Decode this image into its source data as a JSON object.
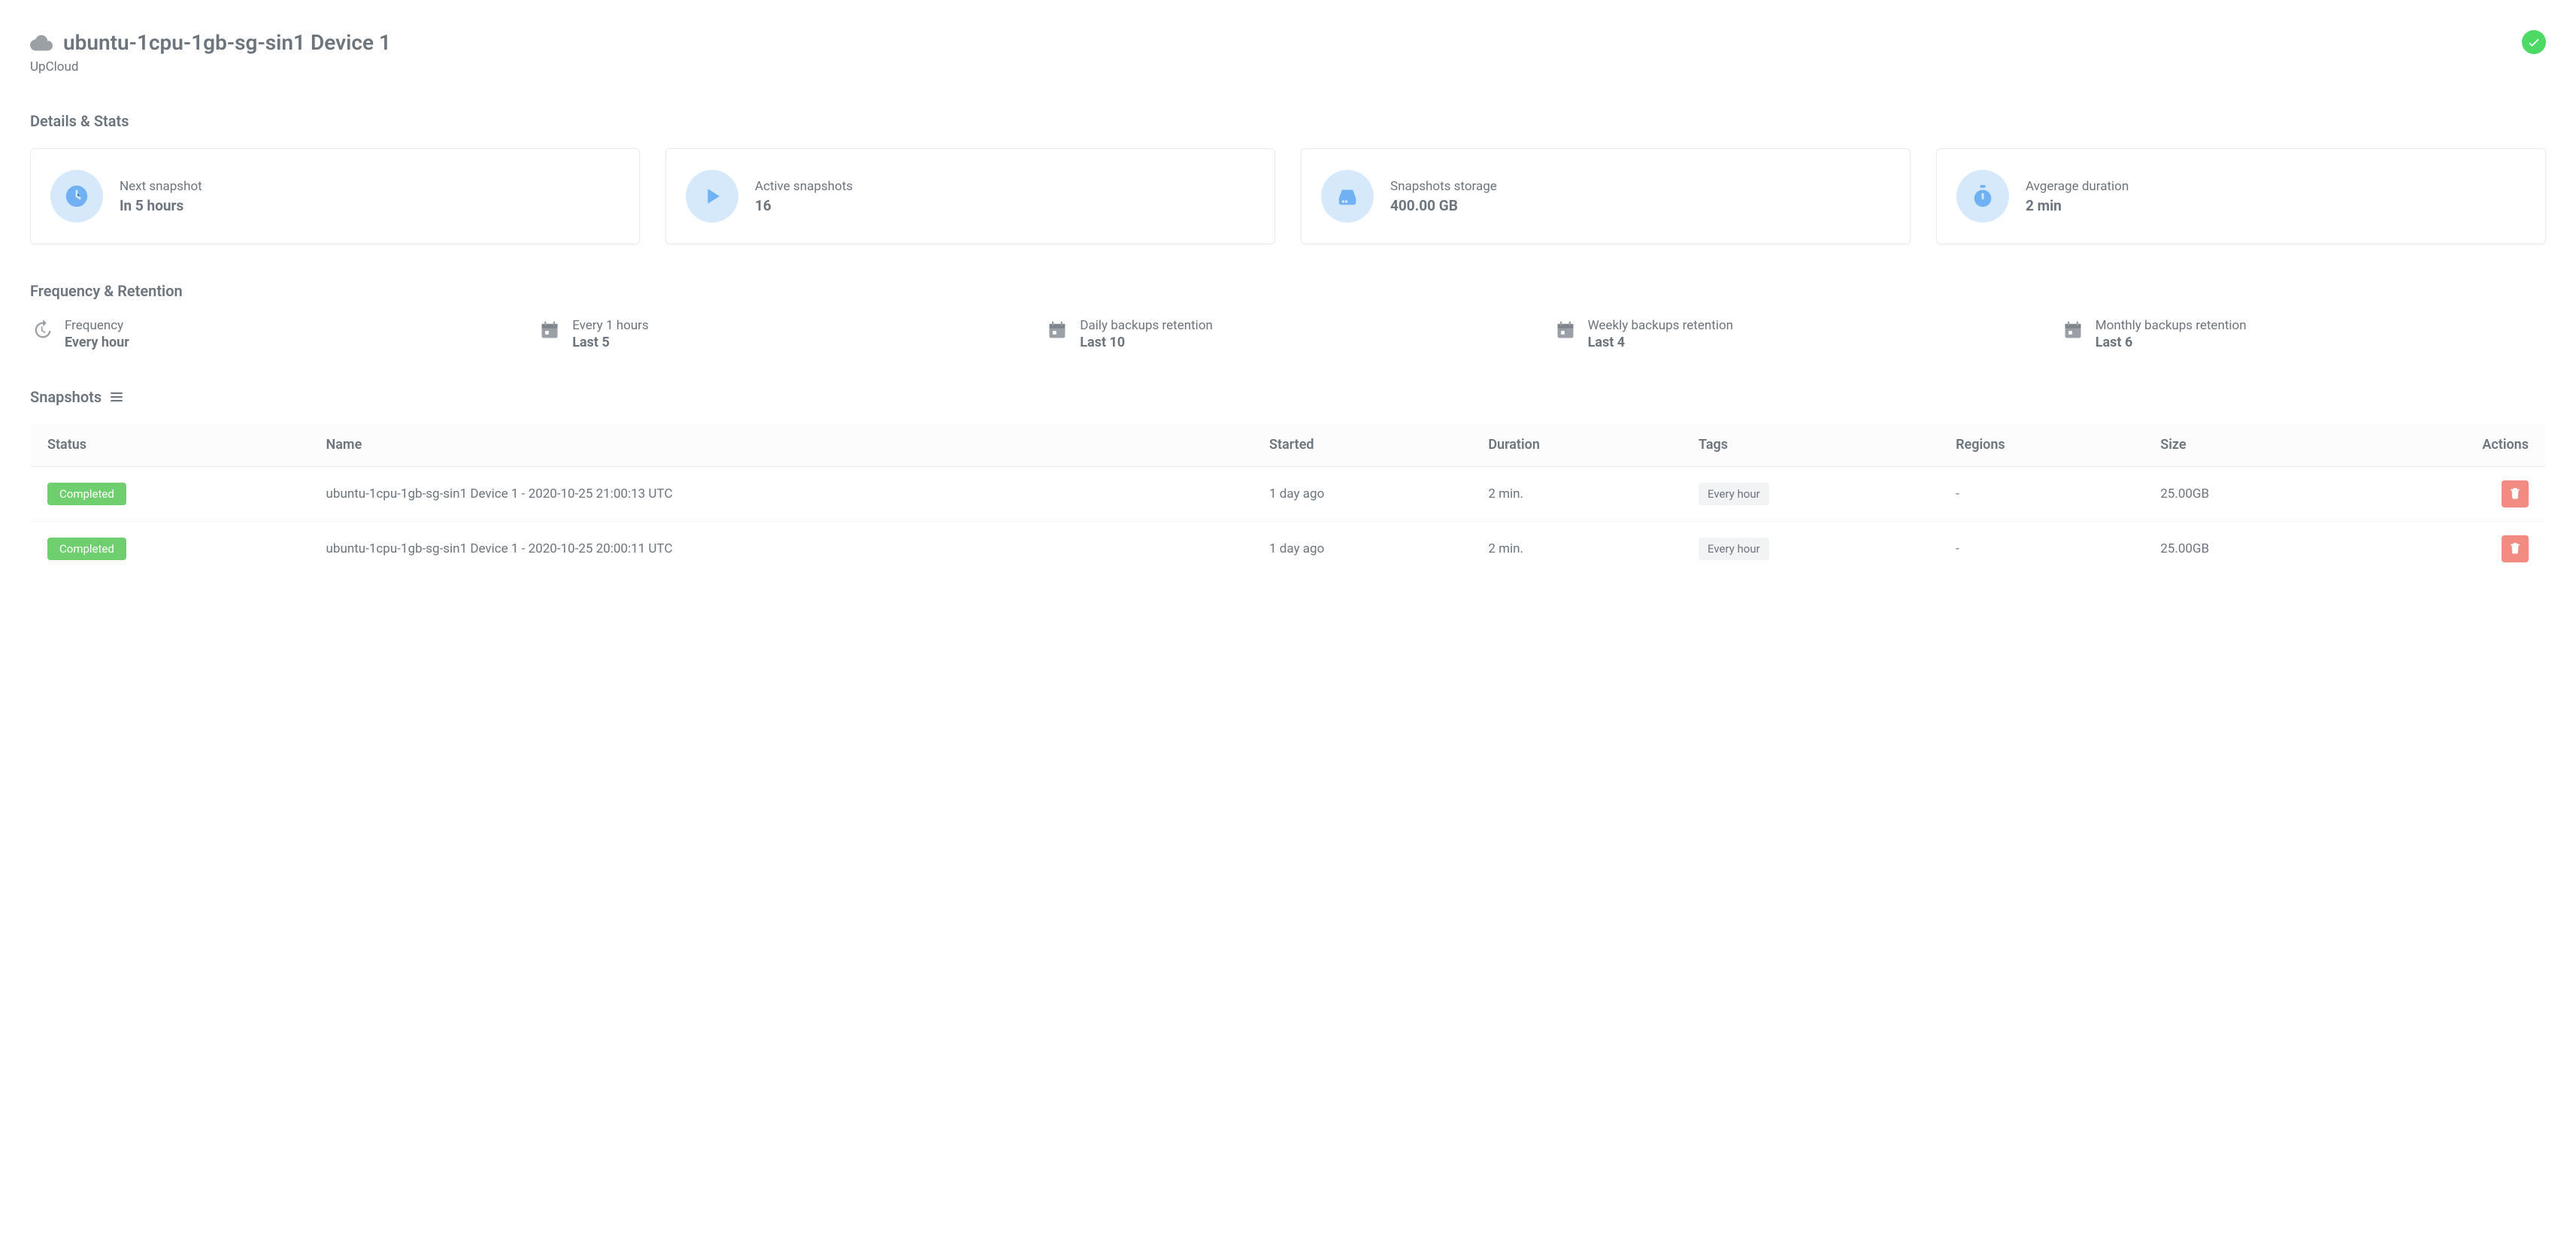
{
  "header": {
    "title": "ubuntu-1cpu-1gb-sg-sin1 Device 1",
    "provider": "UpCloud"
  },
  "sections": {
    "details": "Details & Stats",
    "freq": "Frequency & Retention",
    "snapshots": "Snapshots"
  },
  "stats": [
    {
      "label": "Next snapshot",
      "value": "In 5 hours",
      "icon": "clock"
    },
    {
      "label": "Active snapshots",
      "value": "16",
      "icon": "play"
    },
    {
      "label": "Snapshots storage",
      "value": "400.00 GB",
      "icon": "drive"
    },
    {
      "label": "Avgerage duration",
      "value": "2 min",
      "icon": "stopwatch"
    }
  ],
  "freq": [
    {
      "label": "Frequency",
      "value": "Every hour",
      "icon": "history"
    },
    {
      "label": "Every 1 hours",
      "value": "Last 5",
      "icon": "calendar"
    },
    {
      "label": "Daily backups retention",
      "value": "Last 10",
      "icon": "calendar"
    },
    {
      "label": "Weekly backups retention",
      "value": "Last 4",
      "icon": "calendar"
    },
    {
      "label": "Monthly backups retention",
      "value": "Last 6",
      "icon": "calendar"
    }
  ],
  "table": {
    "columns": [
      "Status",
      "Name",
      "Started",
      "Duration",
      "Tags",
      "Regions",
      "Size",
      "Actions"
    ],
    "rows": [
      {
        "status": "Completed",
        "name": "ubuntu-1cpu-1gb-sg-sin1 Device 1 - 2020-10-25 21:00:13 UTC",
        "started": "1 day ago",
        "duration": "2 min.",
        "tag": "Every hour",
        "regions": "-",
        "size": "25.00GB"
      },
      {
        "status": "Completed",
        "name": "ubuntu-1cpu-1gb-sg-sin1 Device 1 - 2020-10-25 20:00:11 UTC",
        "started": "1 day ago",
        "duration": "2 min.",
        "tag": "Every hour",
        "regions": "-",
        "size": "25.00GB"
      }
    ]
  },
  "colors": {
    "accent_blue": "#6fb1f2",
    "icon_bg": "#d6e9fb",
    "success": "#6fcf6f",
    "danger": "#f28b82",
    "text": "#6c757d",
    "border": "#e9ecef"
  }
}
